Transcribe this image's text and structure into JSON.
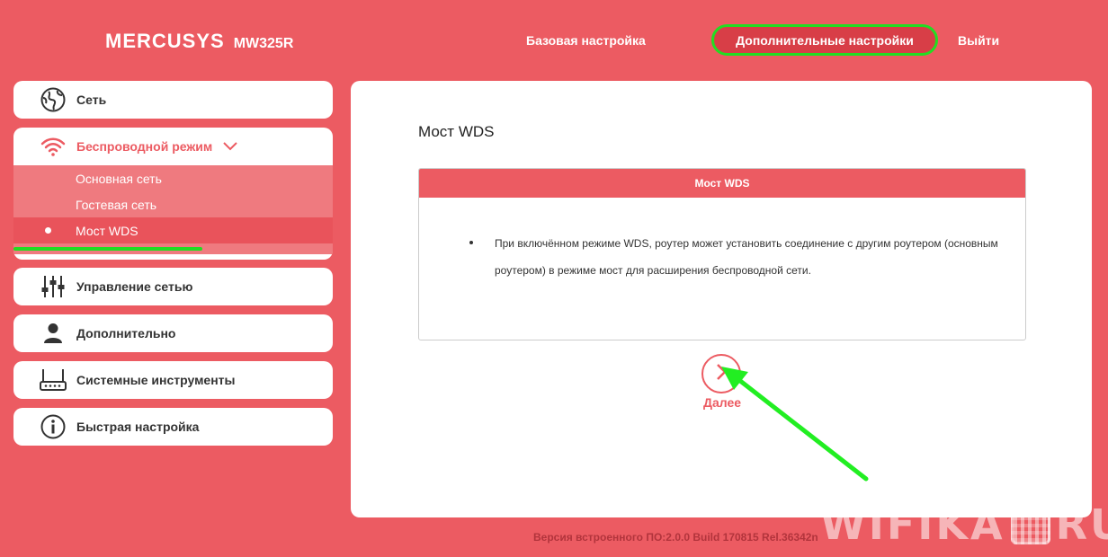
{
  "header": {
    "brand": "MERCUSYS",
    "model": "MW325R",
    "nav": {
      "basic": "Базовая настройка",
      "advanced": "Дополнительные настройки",
      "logout": "Выйти"
    }
  },
  "sidebar": {
    "network": "Сеть",
    "wireless": {
      "label": "Беспроводной режим",
      "items": [
        "Основная сеть",
        "Гостевая сеть",
        "Мост WDS"
      ],
      "active_index": 2
    },
    "network_control": "Управление сетью",
    "advanced": "Дополнительно",
    "system_tools": "Системные инструменты",
    "quick_setup": "Быстрая настройка"
  },
  "main": {
    "title": "Мост WDS",
    "box_title": "Мост WDS",
    "description_line1": "При включённом режиме WDS, роутер может установить соединение с другим роутером (основным",
    "description_line2": "роутером) в режиме мост для расширения беспроводной сети.",
    "next_label": "Далее"
  },
  "footer": {
    "firmware": "Версия встроенного ПО:2.0.0 Build 170815 Rel.36342n"
  },
  "watermark": {
    "left": "WIFIKA",
    "right": "RU"
  },
  "colors": {
    "brand": "#ec5b62",
    "highlight": "#22dd22"
  }
}
